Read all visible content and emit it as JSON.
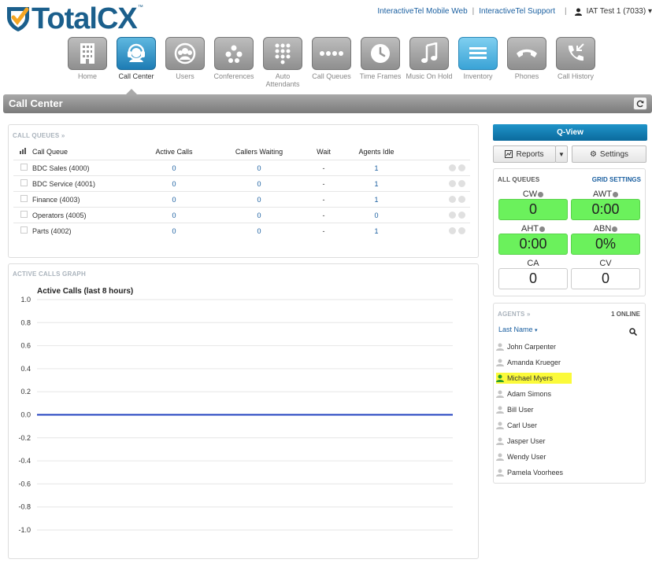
{
  "header": {
    "logo": "TotalCX",
    "logo_tm": "™",
    "links": [
      "InteractiveTel Mobile Web",
      "InteractiveTel Support"
    ],
    "link_separator": "|",
    "user": "IAT Test 1 (7033)"
  },
  "nav": [
    {
      "label": "Home",
      "icon": "building-icon"
    },
    {
      "label": "Call Center",
      "icon": "headset-icon",
      "active": true
    },
    {
      "label": "Users",
      "icon": "users-icon"
    },
    {
      "label": "Conferences",
      "icon": "conference-icon"
    },
    {
      "label": "Auto Attendants",
      "icon": "keypad-icon"
    },
    {
      "label": "Call Queues",
      "icon": "queue-dots-icon"
    },
    {
      "label": "Time Frames",
      "icon": "clock-icon"
    },
    {
      "label": "Music On Hold",
      "icon": "music-note-icon"
    },
    {
      "label": "Inventory",
      "icon": "inventory-list-icon"
    },
    {
      "label": "Phones",
      "icon": "phone-handset-icon"
    },
    {
      "label": "Call History",
      "icon": "call-history-icon"
    }
  ],
  "page_title": "Call Center",
  "call_queues": {
    "title": "CALL QUEUES »",
    "columns": [
      "Call Queue",
      "Active Calls",
      "Callers Waiting",
      "Wait",
      "Agents Idle"
    ],
    "rows": [
      {
        "name": "BDC Sales (4000)",
        "active": "0",
        "waiting": "0",
        "wait": "-",
        "idle": "1"
      },
      {
        "name": "BDC Service (4001)",
        "active": "0",
        "waiting": "0",
        "wait": "-",
        "idle": "1"
      },
      {
        "name": "Finance (4003)",
        "active": "0",
        "waiting": "0",
        "wait": "-",
        "idle": "1"
      },
      {
        "name": "Operators (4005)",
        "active": "0",
        "waiting": "0",
        "wait": "-",
        "idle": "0"
      },
      {
        "name": "Parts (4002)",
        "active": "0",
        "waiting": "0",
        "wait": "-",
        "idle": "1"
      }
    ]
  },
  "graph": {
    "panel_title": "ACTIVE CALLS GRAPH",
    "title": "Active Calls (last 8 hours)"
  },
  "chart_data": {
    "type": "line",
    "title": "Active Calls (last 8 hours)",
    "ylim": [
      -1.0,
      1.0
    ],
    "yticks": [
      "1.0",
      "0.8",
      "0.6",
      "0.4",
      "0.2",
      "0.0",
      "-0.2",
      "-0.4",
      "-0.6",
      "-0.8",
      "-1.0"
    ],
    "series": [
      {
        "values": [
          0,
          0,
          0,
          0,
          0,
          0,
          0,
          0,
          0
        ],
        "color": "#1f3fbf"
      }
    ],
    "grid": true
  },
  "right": {
    "qview": "Q-View",
    "reports": "Reports",
    "settings": "Settings",
    "all_queues": "ALL QUEUES",
    "grid_settings": "GRID SETTINGS",
    "stats": [
      {
        "label": "CW",
        "value": "0",
        "info": true,
        "color": "#6bf15c"
      },
      {
        "label": "AWT",
        "value": "0:00",
        "info": true,
        "color": "#6bf15c"
      },
      {
        "label": "AHT",
        "value": "0:00",
        "info": true,
        "color": "#6bf15c"
      },
      {
        "label": "ABN",
        "value": "0%",
        "info": true,
        "color": "#6bf15c"
      },
      {
        "label": "CA",
        "value": "0",
        "info": false,
        "color": "#ffffff"
      },
      {
        "label": "CV",
        "value": "0",
        "info": false,
        "color": "#ffffff"
      }
    ],
    "agents_title": "AGENTS »",
    "online": "1 ONLINE",
    "sort": "Last Name",
    "agents": [
      {
        "name": "John Carpenter",
        "online": false
      },
      {
        "name": "Amanda Krueger",
        "online": false
      },
      {
        "name": "Michael Myers",
        "online": true
      },
      {
        "name": "Adam Simons",
        "online": false
      },
      {
        "name": "Bill User",
        "online": false
      },
      {
        "name": "Carl User",
        "online": false
      },
      {
        "name": "Jasper User",
        "online": false
      },
      {
        "name": "Wendy User",
        "online": false
      },
      {
        "name": "Pamela Voorhees",
        "online": false
      }
    ]
  }
}
